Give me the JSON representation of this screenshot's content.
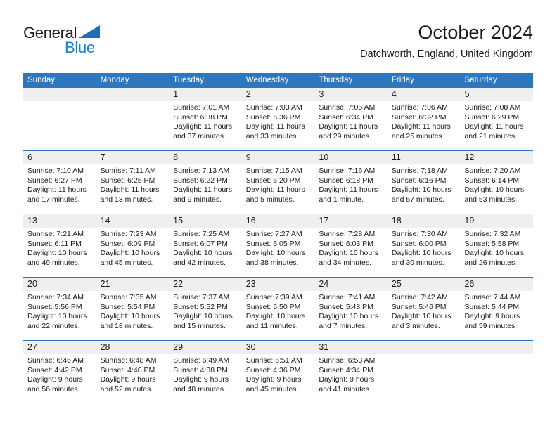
{
  "brand": {
    "name_top": "General",
    "name_bottom": "Blue",
    "accent_color": "#1c7fd6",
    "triangle_color": "#1c6fb8"
  },
  "header": {
    "title": "October 2024",
    "subtitle": "Datchworth, England, United Kingdom"
  },
  "theme": {
    "header_blue": "#2f77bc",
    "daynum_band": "#efefef",
    "text": "#1a1a1a"
  },
  "weekdays": [
    "Sunday",
    "Monday",
    "Tuesday",
    "Wednesday",
    "Thursday",
    "Friday",
    "Saturday"
  ],
  "weeks": [
    [
      {
        "day": "",
        "lines": []
      },
      {
        "day": "",
        "lines": []
      },
      {
        "day": "1",
        "lines": [
          "Sunrise: 7:01 AM",
          "Sunset: 6:38 PM",
          "Daylight: 11 hours",
          "and 37 minutes."
        ]
      },
      {
        "day": "2",
        "lines": [
          "Sunrise: 7:03 AM",
          "Sunset: 6:36 PM",
          "Daylight: 11 hours",
          "and 33 minutes."
        ]
      },
      {
        "day": "3",
        "lines": [
          "Sunrise: 7:05 AM",
          "Sunset: 6:34 PM",
          "Daylight: 11 hours",
          "and 29 minutes."
        ]
      },
      {
        "day": "4",
        "lines": [
          "Sunrise: 7:06 AM",
          "Sunset: 6:32 PM",
          "Daylight: 11 hours",
          "and 25 minutes."
        ]
      },
      {
        "day": "5",
        "lines": [
          "Sunrise: 7:08 AM",
          "Sunset: 6:29 PM",
          "Daylight: 11 hours",
          "and 21 minutes."
        ]
      }
    ],
    [
      {
        "day": "6",
        "lines": [
          "Sunrise: 7:10 AM",
          "Sunset: 6:27 PM",
          "Daylight: 11 hours",
          "and 17 minutes."
        ]
      },
      {
        "day": "7",
        "lines": [
          "Sunrise: 7:11 AM",
          "Sunset: 6:25 PM",
          "Daylight: 11 hours",
          "and 13 minutes."
        ]
      },
      {
        "day": "8",
        "lines": [
          "Sunrise: 7:13 AM",
          "Sunset: 6:22 PM",
          "Daylight: 11 hours",
          "and 9 minutes."
        ]
      },
      {
        "day": "9",
        "lines": [
          "Sunrise: 7:15 AM",
          "Sunset: 6:20 PM",
          "Daylight: 11 hours",
          "and 5 minutes."
        ]
      },
      {
        "day": "10",
        "lines": [
          "Sunrise: 7:16 AM",
          "Sunset: 6:18 PM",
          "Daylight: 11 hours",
          "and 1 minute."
        ]
      },
      {
        "day": "11",
        "lines": [
          "Sunrise: 7:18 AM",
          "Sunset: 6:16 PM",
          "Daylight: 10 hours",
          "and 57 minutes."
        ]
      },
      {
        "day": "12",
        "lines": [
          "Sunrise: 7:20 AM",
          "Sunset: 6:14 PM",
          "Daylight: 10 hours",
          "and 53 minutes."
        ]
      }
    ],
    [
      {
        "day": "13",
        "lines": [
          "Sunrise: 7:21 AM",
          "Sunset: 6:11 PM",
          "Daylight: 10 hours",
          "and 49 minutes."
        ]
      },
      {
        "day": "14",
        "lines": [
          "Sunrise: 7:23 AM",
          "Sunset: 6:09 PM",
          "Daylight: 10 hours",
          "and 45 minutes."
        ]
      },
      {
        "day": "15",
        "lines": [
          "Sunrise: 7:25 AM",
          "Sunset: 6:07 PM",
          "Daylight: 10 hours",
          "and 42 minutes."
        ]
      },
      {
        "day": "16",
        "lines": [
          "Sunrise: 7:27 AM",
          "Sunset: 6:05 PM",
          "Daylight: 10 hours",
          "and 38 minutes."
        ]
      },
      {
        "day": "17",
        "lines": [
          "Sunrise: 7:28 AM",
          "Sunset: 6:03 PM",
          "Daylight: 10 hours",
          "and 34 minutes."
        ]
      },
      {
        "day": "18",
        "lines": [
          "Sunrise: 7:30 AM",
          "Sunset: 6:00 PM",
          "Daylight: 10 hours",
          "and 30 minutes."
        ]
      },
      {
        "day": "19",
        "lines": [
          "Sunrise: 7:32 AM",
          "Sunset: 5:58 PM",
          "Daylight: 10 hours",
          "and 26 minutes."
        ]
      }
    ],
    [
      {
        "day": "20",
        "lines": [
          "Sunrise: 7:34 AM",
          "Sunset: 5:56 PM",
          "Daylight: 10 hours",
          "and 22 minutes."
        ]
      },
      {
        "day": "21",
        "lines": [
          "Sunrise: 7:35 AM",
          "Sunset: 5:54 PM",
          "Daylight: 10 hours",
          "and 18 minutes."
        ]
      },
      {
        "day": "22",
        "lines": [
          "Sunrise: 7:37 AM",
          "Sunset: 5:52 PM",
          "Daylight: 10 hours",
          "and 15 minutes."
        ]
      },
      {
        "day": "23",
        "lines": [
          "Sunrise: 7:39 AM",
          "Sunset: 5:50 PM",
          "Daylight: 10 hours",
          "and 11 minutes."
        ]
      },
      {
        "day": "24",
        "lines": [
          "Sunrise: 7:41 AM",
          "Sunset: 5:48 PM",
          "Daylight: 10 hours",
          "and 7 minutes."
        ]
      },
      {
        "day": "25",
        "lines": [
          "Sunrise: 7:42 AM",
          "Sunset: 5:46 PM",
          "Daylight: 10 hours",
          "and 3 minutes."
        ]
      },
      {
        "day": "26",
        "lines": [
          "Sunrise: 7:44 AM",
          "Sunset: 5:44 PM",
          "Daylight: 9 hours",
          "and 59 minutes."
        ]
      }
    ],
    [
      {
        "day": "27",
        "lines": [
          "Sunrise: 6:46 AM",
          "Sunset: 4:42 PM",
          "Daylight: 9 hours",
          "and 56 minutes."
        ]
      },
      {
        "day": "28",
        "lines": [
          "Sunrise: 6:48 AM",
          "Sunset: 4:40 PM",
          "Daylight: 9 hours",
          "and 52 minutes."
        ]
      },
      {
        "day": "29",
        "lines": [
          "Sunrise: 6:49 AM",
          "Sunset: 4:38 PM",
          "Daylight: 9 hours",
          "and 48 minutes."
        ]
      },
      {
        "day": "30",
        "lines": [
          "Sunrise: 6:51 AM",
          "Sunset: 4:36 PM",
          "Daylight: 9 hours",
          "and 45 minutes."
        ]
      },
      {
        "day": "31",
        "lines": [
          "Sunrise: 6:53 AM",
          "Sunset: 4:34 PM",
          "Daylight: 9 hours",
          "and 41 minutes."
        ]
      },
      {
        "day": "",
        "lines": []
      },
      {
        "day": "",
        "lines": []
      }
    ]
  ]
}
